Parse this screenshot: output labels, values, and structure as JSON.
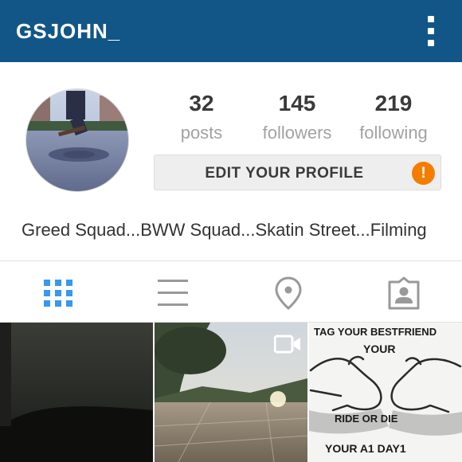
{
  "header": {
    "username": "GSJOHN_",
    "menu_icon": "more-vertical-icon"
  },
  "stats": [
    {
      "value": "32",
      "label": "posts"
    },
    {
      "value": "145",
      "label": "followers"
    },
    {
      "value": "219",
      "label": "following"
    }
  ],
  "edit_profile": {
    "label": "EDIT YOUR PROFILE",
    "alert_glyph": "!"
  },
  "bio": "Greed Squad...BWW Squad...Skatin Street...Filming",
  "tabs": [
    {
      "icon": "grid-icon",
      "active": true
    },
    {
      "icon": "list-icon",
      "active": false
    },
    {
      "icon": "location-pin-icon",
      "active": false
    },
    {
      "icon": "tagged-person-icon",
      "active": false
    }
  ],
  "posts": [
    {
      "type": "photo"
    },
    {
      "type": "video"
    },
    {
      "type": "photo",
      "text_lines": [
        "TAG YOUR BESTFRIEND",
        "YOUR",
        "RIDE OR DIE",
        "YOUR A1 DAY1"
      ]
    }
  ],
  "colors": {
    "header_bg": "#125688",
    "active_tab": "#3897f0",
    "inactive_tab": "#999999",
    "alert": "#f47d00"
  }
}
